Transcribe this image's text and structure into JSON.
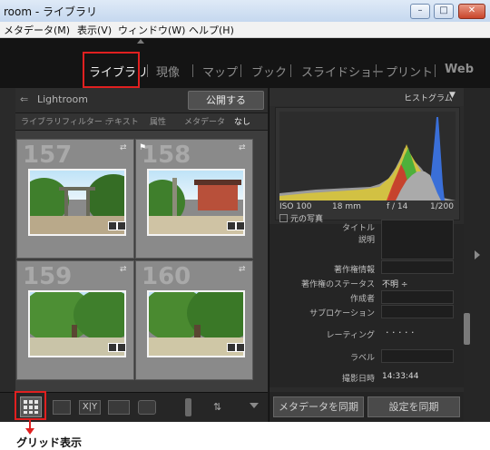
{
  "window": {
    "title": "room - ライブラリ"
  },
  "menu": {
    "items": [
      "メタデータ(M)",
      "表示(V)",
      "ウィンドウ(W)",
      "ヘルプ(H)"
    ]
  },
  "modules": {
    "items": [
      "ライブラリ",
      "現像",
      "マップ",
      "ブック",
      "スライドショー",
      "プリント",
      "Web"
    ],
    "active": "ライブラリ"
  },
  "left_panel": {
    "header": "Lightroom",
    "publish_button": "公開する"
  },
  "filter_bar": {
    "label": "ライブラリフィルター :",
    "items": [
      "テキスト",
      "属性",
      "メタデータ",
      "なし"
    ],
    "active": "なし"
  },
  "grid": {
    "cells": [
      {
        "number": "157"
      },
      {
        "number": "158"
      },
      {
        "number": "159"
      },
      {
        "number": "160"
      }
    ]
  },
  "histogram": {
    "title": "ヒストグラム",
    "iso": "ISO 100",
    "focal": "18 mm",
    "aperture": "f / 14",
    "shutter": "1/200",
    "original_photo": "元の写真"
  },
  "metadata": {
    "title_label": "タイトル",
    "caption_label": "説明",
    "copyright_label": "著作権情報",
    "copyright_status_label": "著作権のステータス",
    "copyright_status_value": "不明 ÷",
    "creator_label": "作成者",
    "sublocation_label": "サブロケーション",
    "rating_label": "レーティング",
    "rating_value": "·  ·  ·  ·  ·",
    "label_label": "ラベル",
    "capture_time_label": "撮影日時",
    "capture_time_value": "14:33:44"
  },
  "right_buttons": {
    "sync_metadata": "メタデータを同期",
    "sync_settings": "設定を同期"
  },
  "callout": {
    "label": "グリッド表示"
  },
  "colors": {
    "highlight": "#e02020",
    "panel": "#2b2b2b",
    "grid_bg": "#3d3d3d"
  }
}
